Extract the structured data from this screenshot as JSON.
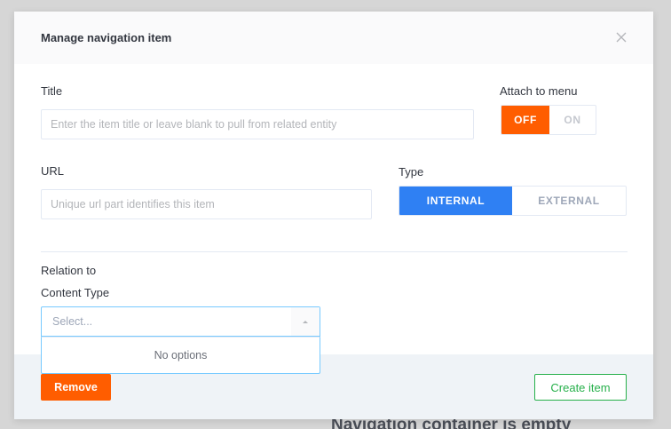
{
  "background": {
    "empty_message": "Navigation container is empty"
  },
  "modal": {
    "title": "Manage navigation item",
    "close_icon": "close-icon"
  },
  "form": {
    "title": {
      "label": "Title",
      "value": "",
      "placeholder": "Enter the item title or leave blank to pull from related entity"
    },
    "attach_to_menu": {
      "label": "Attach to menu",
      "options": [
        "OFF",
        "ON"
      ],
      "selected": "OFF"
    },
    "url": {
      "label": "URL",
      "value": "",
      "placeholder": "Unique url part identifies this item"
    },
    "type": {
      "label": "Type",
      "options": [
        "INTERNAL",
        "EXTERNAL"
      ],
      "selected": "INTERNAL"
    },
    "relation": {
      "section_label": "Relation to",
      "content_type_label": "Content Type",
      "placeholder": "Select...",
      "menu_message": "No options"
    }
  },
  "footer": {
    "remove_label": "Remove",
    "create_label": "Create item"
  },
  "colors": {
    "accent_orange": "#ff5d00",
    "accent_blue": "#2f80f3",
    "success_green": "#27b04b",
    "focus_border": "#78caff"
  }
}
